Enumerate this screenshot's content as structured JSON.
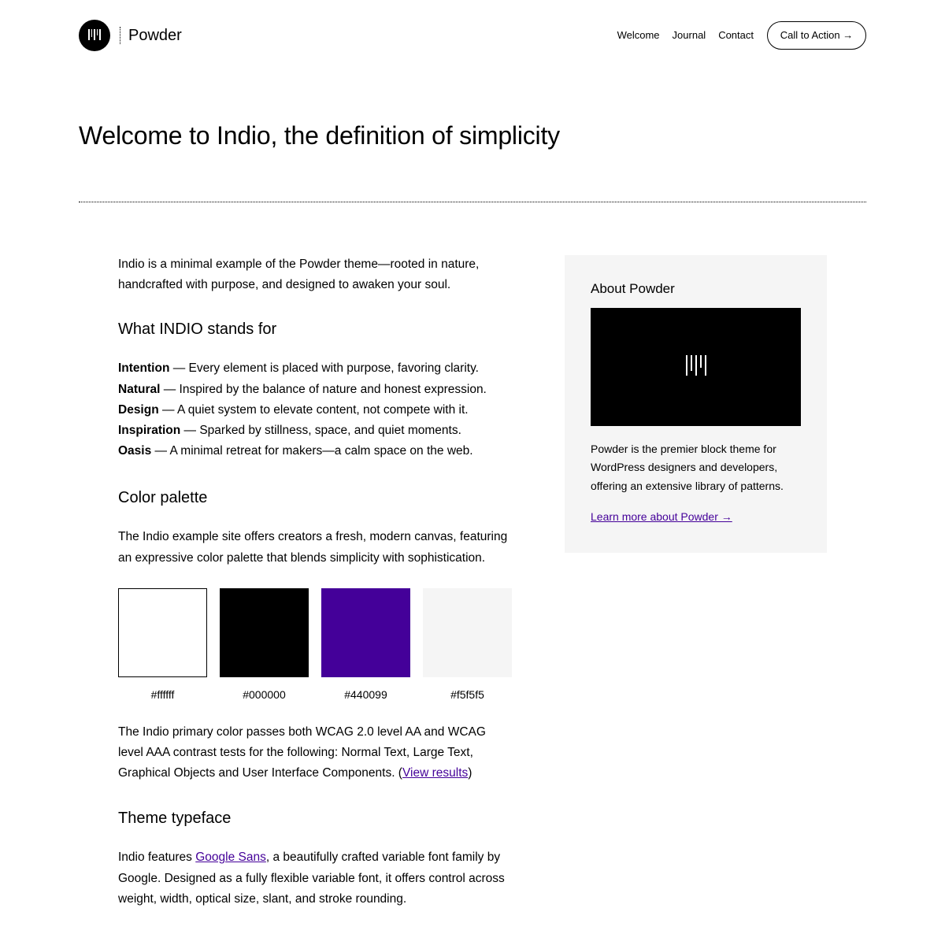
{
  "header": {
    "site_title": "Powder",
    "logo_icon": "powder-logo-mark",
    "nav": [
      "Welcome",
      "Journal",
      "Contact"
    ],
    "cta_label": "Call to Action →"
  },
  "page": {
    "title": "Welcome to Indio, the definition of simplicity"
  },
  "main": {
    "intro": "Indio is a minimal example of the Powder theme—rooted in nature, handcrafted with purpose, and designed to awaken your soul.",
    "stands_heading": "What INDIO stands for",
    "stands": [
      {
        "term": "Intention",
        "desc": " — Every element is placed with purpose, favoring clarity."
      },
      {
        "term": "Natural",
        "desc": " — Inspired by the balance of nature and honest expression."
      },
      {
        "term": "Design",
        "desc": " — A quiet system to elevate content, not compete with it."
      },
      {
        "term": "Inspiration",
        "desc": " — Sparked by stillness, space, and quiet moments."
      },
      {
        "term": "Oasis",
        "desc": " — A minimal retreat for makers—a calm space on the web."
      }
    ],
    "palette_heading": "Color palette",
    "palette_desc": "The Indio example site offers creators a fresh, modern canvas, featuring an expressive color palette that blends simplicity with sophistication.",
    "swatches": [
      {
        "label": "#ffffff",
        "color": "#ffffff"
      },
      {
        "label": "#000000",
        "color": "#000000"
      },
      {
        "label": "#440099",
        "color": "#440099"
      },
      {
        "label": "#f5f5f5",
        "color": "#f5f5f5"
      }
    ],
    "wcag_text": "The Indio primary color passes both WCAG 2.0 level AA and WCAG level AAA contrast tests for the following: Normal Text, Large Text, Graphical Objects and User Interface Components. (",
    "wcag_link": "View results",
    "wcag_close": ")",
    "typeface_heading": "Theme typeface",
    "typeface_pre": "Indio features ",
    "typeface_link": "Google Sans",
    "typeface_post": ", a beautifully crafted variable font family by Google. Designed as a fully flexible variable font, it offers control across weight, width, optical size, slant, and stroke rounding."
  },
  "sidebar": {
    "heading": "About Powder",
    "image_icon": "powder-logo-mark",
    "desc": "Powder is the premier block theme for WordPress designers and developers, offering an extensive library of patterns.",
    "link": "Learn more about Powder →"
  },
  "colors": {
    "accent": "#440099",
    "sidebar_bg": "#f5f5f5",
    "text": "#000000"
  }
}
